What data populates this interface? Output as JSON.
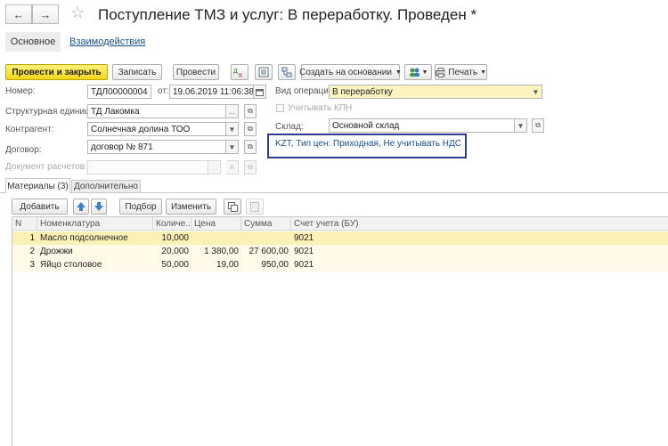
{
  "window": {
    "title": "Поступление ТМЗ и услуг: В переработку. Проведен *",
    "back_icon": "←",
    "forward_icon": "→",
    "star_icon": "☆"
  },
  "tabs": {
    "main": "Основное",
    "links": "Взаимодействия"
  },
  "toolbar": {
    "post_close": "Провести и закрыть",
    "save": "Записать",
    "post": "Провести",
    "create_based": "Создать на основании",
    "print": "Печать"
  },
  "form": {
    "number_label": "Номер:",
    "number_value": "ТДЛ00000004",
    "date_label": "от:",
    "date_value": "19.06.2019 11:06:38",
    "operation_label": "Вид операции:",
    "operation_value": "В переработку",
    "unit_label": "Структурная единица:",
    "unit_value": "ТД Лакомка",
    "kpn_label": "Учитывать КПН",
    "counterparty_label": "Контрагент:",
    "counterparty_value": "Солнечная долина ТОО",
    "warehouse_label": "Склад:",
    "warehouse_value": "Основной склад",
    "contract_label": "Договор:",
    "contract_value": "договор № 871",
    "settlement_label": "Документ расчетов:",
    "settlement_value": "",
    "info_link": "KZT, Тип цен: Приходная, Не учитывать НДС"
  },
  "page_tabs": {
    "materials": "Материалы (3)",
    "additional": "Дополнительно"
  },
  "table_toolbar": {
    "add": "Добавить",
    "pick": "Подбор",
    "change": "Изменить"
  },
  "table": {
    "headers": [
      "N",
      "Номенклатура",
      "Количе...",
      "Цена",
      "Сумма",
      "Счет учета (БУ)"
    ],
    "rows": [
      [
        "1",
        "Масло подсолнечное",
        "10,000",
        "",
        "",
        "9021"
      ],
      [
        "2",
        "Дрожжи",
        "20,000",
        "1 380,00",
        "27 600,00",
        "9021"
      ],
      [
        "3",
        "Яйцо столовое",
        "50,000",
        "19,00",
        "950,00",
        "9021"
      ]
    ]
  },
  "colors": {
    "primary_button": "#f3d71a",
    "selected_row": "#fbf1b4",
    "highlight_box": "#2e3b8f",
    "link": "#1a4f8a"
  }
}
